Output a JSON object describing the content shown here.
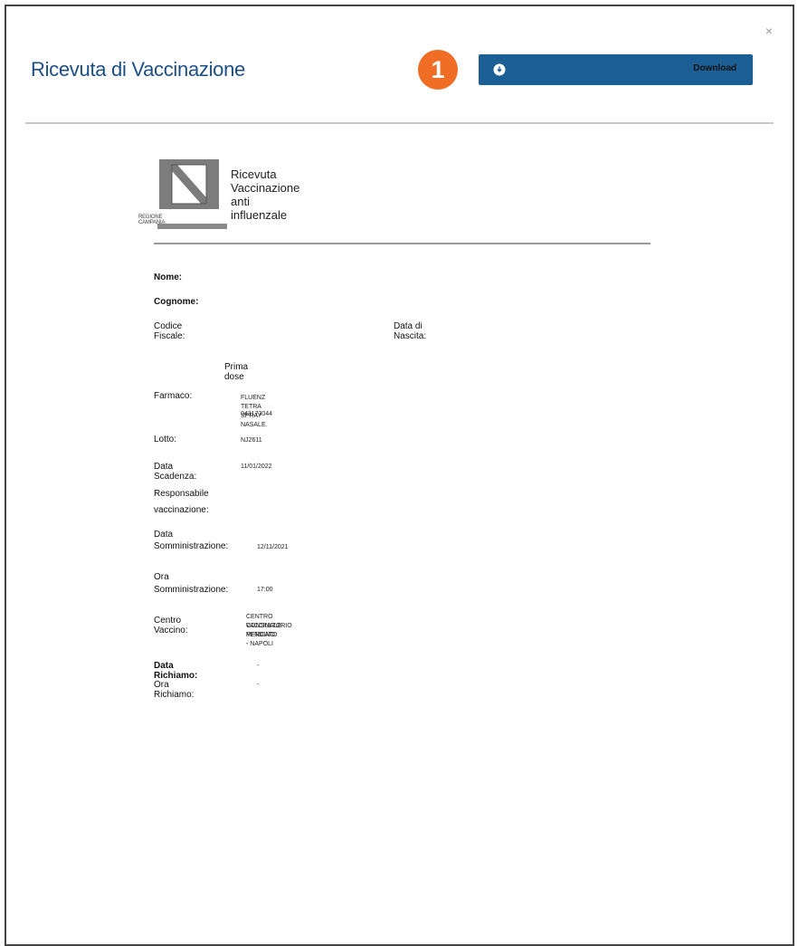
{
  "dialog": {
    "title": "Ricevuta di Vaccinazione",
    "close_glyph": "×",
    "step_badge": "1",
    "download_label": "Download",
    "download_icon": "download-icon",
    "accent_color": "#1b5f94",
    "badge_color": "#ef6d24"
  },
  "receipt": {
    "logo_caption": "REGIONE CAMPANIA",
    "title": "Ricevuta Vaccinazione anti influenzale",
    "labels": {
      "nome": "Nome:",
      "cognome": "Cognome:",
      "codice_fiscale": "Codice Fiscale:",
      "data_nascita": "Data di Nascita:",
      "prima_dose": "Prima dose",
      "farmaco": "Farmaco:",
      "lotto": "Lotto:",
      "data_scadenza": "Data Scadenza:",
      "responsabile_1": "Responsabile",
      "responsabile_2": "vaccinazione:",
      "data_somm_1": "Data",
      "data_somm_2": "Somministrazione:",
      "ora_somm_1": "Ora",
      "ora_somm_2": "Somministrazione:",
      "centro": "Centro Vaccino:",
      "data_richiamo": "Data Richiamo:",
      "ora_richiamo": "Ora Richiamo:"
    },
    "values": {
      "farmaco_1": "FLUENZ TETRA SPRAY NASALE.",
      "farmaco_2": "043173044",
      "lotto": "NJ2611",
      "data_scadenza": "11/01/2022",
      "data_somm": "12/11/2021",
      "ora_somm": "17:00",
      "centro_1": "CENTRO VACCINALE",
      "centro_2": "CONSULTORIO MERCATO",
      "centro_3": "PENDINO  -  NAPOLI",
      "data_richiamo": "-",
      "ora_richiamo": "-"
    }
  }
}
